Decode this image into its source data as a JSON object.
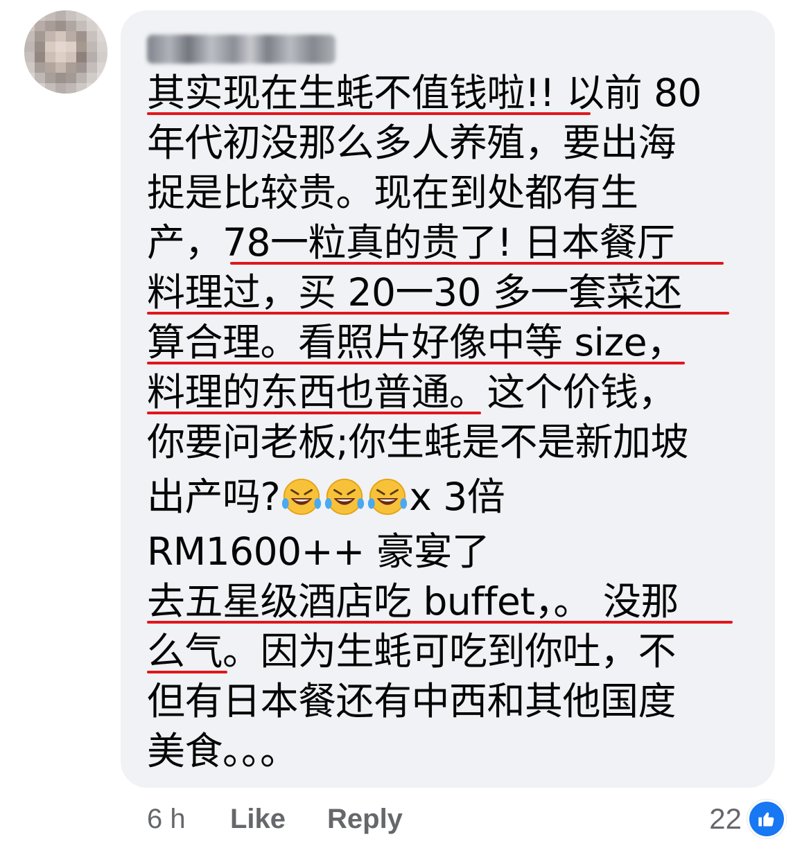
{
  "comment": {
    "author": "Mary Fong",
    "lines": [
      "其实现在生蚝不值钱啦!! 以前 80",
      "年代初没那么多人养殖，要出海",
      "捉是比较贵。现在到处都有生",
      "产，78一粒真的贵了! 日本餐厅",
      "料理过，买 20一30 多一套菜还",
      "算合理。看照片好像中等 size，",
      "料理的东西也普通。这个价钱，",
      "你要问老板;你生蚝是不是新加坡",
      "出产吗?",
      "RM1600++ 豪宴了",
      "去五星级酒店吃 buffet，。 没那",
      "么气。因为生蚝可吃到你吐，不",
      "但有日本餐还有中西和其他国度",
      "美食。。。"
    ],
    "line9_suffix": "x 3倍",
    "emoji": [
      "rofl-emoji",
      "rofl-emoji",
      "rofl-emoji"
    ]
  },
  "footer": {
    "time": "6 h",
    "like_label": "Like",
    "reply_label": "Reply"
  },
  "reactions": {
    "count": "22",
    "icon": "like-icon",
    "badge_color": "#1877f2"
  },
  "colors": {
    "bubble": "#f0f2f5",
    "text": "#050505",
    "meta": "#65676b",
    "underline": "#e0161c"
  }
}
